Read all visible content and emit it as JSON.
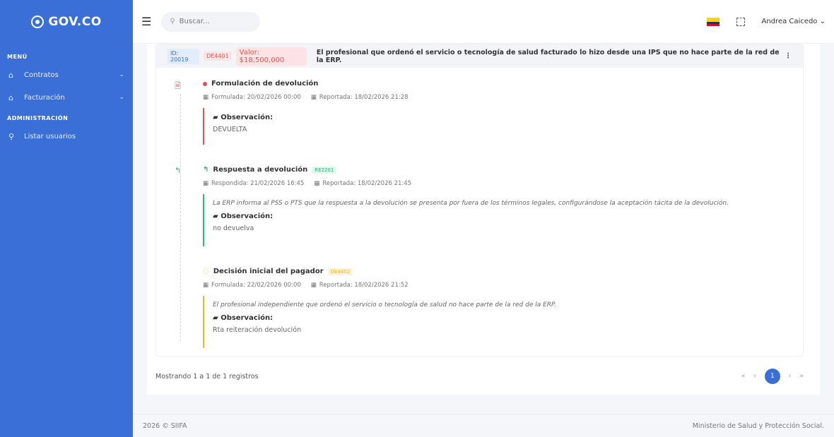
{
  "brand": {
    "logo_text": "GOV.CO"
  },
  "sidebar": {
    "menu_title": "MENÚ",
    "items": [
      {
        "label": "Contratos",
        "icon": "home-icon"
      },
      {
        "label": "Facturación",
        "icon": "home-icon"
      }
    ],
    "admin_title": "ADMINISTRACIÓN",
    "admin_items": [
      {
        "label": "Listar usuarios",
        "icon": "user-icon"
      }
    ]
  },
  "topbar": {
    "search_placeholder": "Buscar...",
    "user_name": "Andrea Caicedo"
  },
  "header": {
    "id_badge": "ID: 20019",
    "code_badge": "DE4401",
    "value_badge": "Valor: $18,500,000",
    "title": "El profesional que ordenó el servicio o tecnología de salud facturado lo hizo desde una IPS que no hace parte de la red de la ERP."
  },
  "entries": [
    {
      "title": "Formulación de devolución",
      "badge": "",
      "meta1": "Formulada: 20/02/2026 00:00",
      "meta2": "Reportada: 18/02/2026 21:28",
      "italic": "",
      "obs_label": "Observación:",
      "obs_value": "DEVUELTA",
      "color": "#e05252"
    },
    {
      "title": "Respuesta a devolución",
      "badge": "RE2201",
      "meta1": "Respondida: 21/02/2026 16:45",
      "meta2": "Reportada: 18/02/2026 21:45",
      "italic": "La ERP informa al PSS o PTS que la respuesta a la devolución se presenta por fuera de los términos legales, configurándose la aceptación tácita de la devolución.",
      "obs_label": "Observación:",
      "obs_value": "no devuelva",
      "color": "#2bb673"
    },
    {
      "title": "Decisión inicial del pagador",
      "badge": "DE4402",
      "meta1": "Formulada: 22/02/2026 00:00",
      "meta2": "Reportada: 18/02/2026 21:52",
      "italic": "El profesional independiente que ordenó el servicio o tecnología de salud no hace parte de la red de la ERP.",
      "obs_label": "Observación:",
      "obs_value": "Rta reiteración devolución",
      "color": "#f0b429"
    }
  ],
  "table_footer": {
    "showing": "Mostrando 1 a 1 de 1 registros",
    "current_page": "1"
  },
  "footer": {
    "left": "2026 © SIIFA",
    "right": "Ministerio de Salud y Protección Social."
  }
}
